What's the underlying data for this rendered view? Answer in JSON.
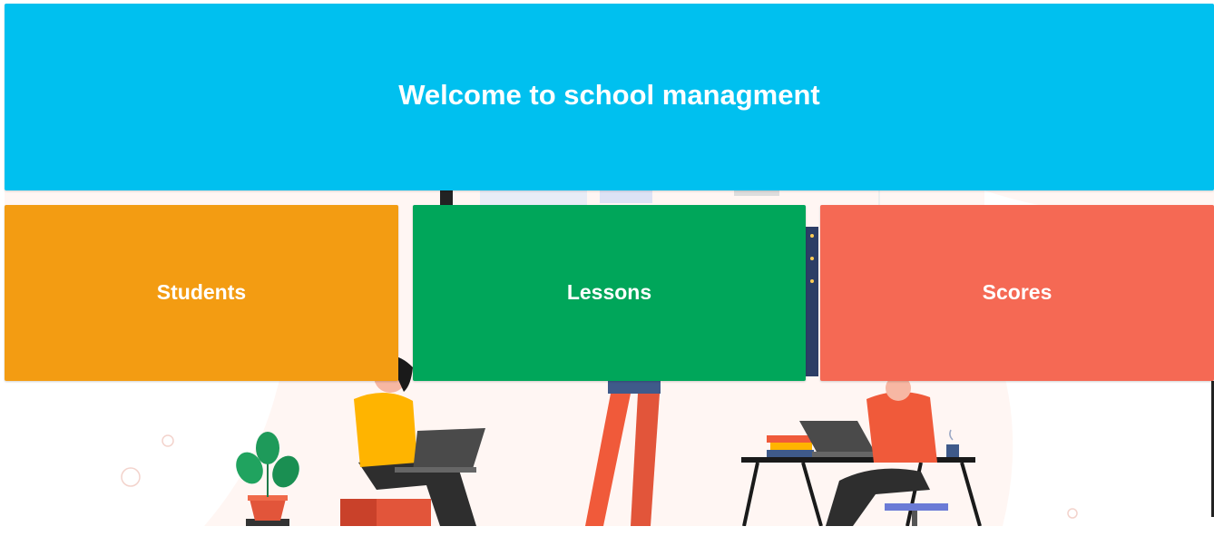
{
  "header": {
    "title": "Welcome to school managment",
    "color": "#00c0ef"
  },
  "tiles": [
    {
      "label": "Students",
      "color": "#f39c12"
    },
    {
      "label": "Lessons",
      "color": "#00a65a"
    },
    {
      "label": "Scores",
      "color": "#f56954"
    }
  ],
  "illustration": {
    "description_icon": "office-workers-illustration"
  }
}
